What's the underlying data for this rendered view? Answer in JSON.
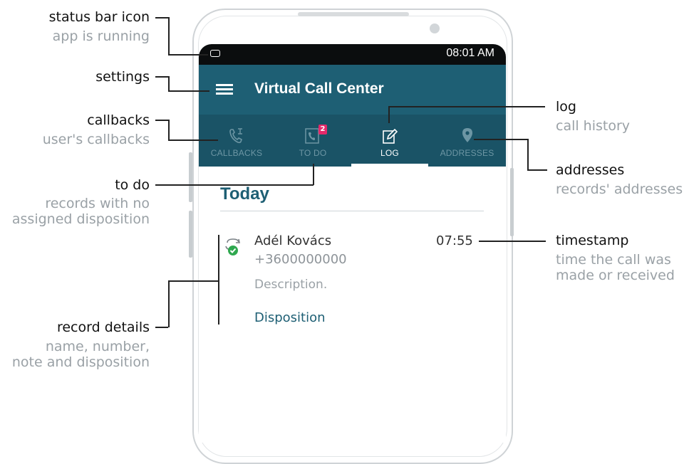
{
  "annotations": {
    "status_bar": {
      "title": "status bar icon",
      "subtitle": "app is running"
    },
    "settings": {
      "title": "settings"
    },
    "callbacks": {
      "title": "callbacks",
      "subtitle": "user's callbacks"
    },
    "todo": {
      "title": "to do",
      "subtitle_line1": "records with no",
      "subtitle_line2": "assigned disposition"
    },
    "record_details": {
      "title": "record details",
      "subtitle_line1": "name, number,",
      "subtitle_line2": "note and disposition"
    },
    "log": {
      "title": "log",
      "subtitle": "call history"
    },
    "addresses": {
      "title": "addresses",
      "subtitle": "records' addresses"
    },
    "timestamp": {
      "title": "timestamp",
      "subtitle_line1": "time the call was",
      "subtitle_line2": "made or received"
    }
  },
  "status_bar": {
    "time": "08:01 AM"
  },
  "app": {
    "title": "Virtual Call Center"
  },
  "tabs": [
    {
      "label": "CALLBACKS",
      "icon": "callback-phone-icon",
      "active": false
    },
    {
      "label": "TO DO",
      "icon": "todo-phone-icon",
      "active": false,
      "badge": "2"
    },
    {
      "label": "LOG",
      "icon": "log-edit-icon",
      "active": true
    },
    {
      "label": "ADDRESSES",
      "icon": "location-pin-icon",
      "active": false
    }
  ],
  "section": {
    "heading": "Today"
  },
  "record": {
    "name": "Adél Kovács",
    "phone": "+3600000000",
    "description": "Description.",
    "disposition": "Disposition",
    "time": "07:55",
    "icon": "call-completed-icon"
  },
  "colors": {
    "toolbar": "#1e5f74",
    "tabs": "#1a5366",
    "badge": "#e5296a",
    "check": "#2fa84f"
  }
}
